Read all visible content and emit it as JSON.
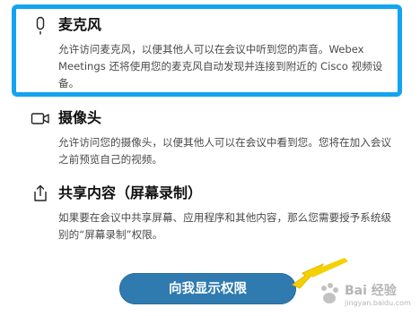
{
  "permissions": [
    {
      "id": "microphone",
      "icon": "microphone-icon",
      "title": "麦克风",
      "description": "允许访问麦克风，以便其他人可以在会议中听到您的声音。Webex Meetings 还将使用您的麦克风自动发现并连接到附近的 Cisco 视频设备。"
    },
    {
      "id": "camera",
      "icon": "camera-icon",
      "title": "摄像头",
      "description": "允许访问您的摄像头，以便其他人可以在会议中看到您。您将在加入会议之前预览自己的视频。"
    },
    {
      "id": "screen-share",
      "icon": "share-icon",
      "title": "共享内容（屏幕录制）",
      "description": "如果要在会议中共享屏幕、应用程序和其他内容，那么您需要授予系统级别的“屏幕录制”权限。"
    }
  ],
  "button": {
    "label": "向我显示权限"
  },
  "watermark": {
    "text": "Bai 经验",
    "sub": "jingyan.baidu.com"
  },
  "colors": {
    "highlight": "#12a4f0",
    "button": "#2f7bb0",
    "arrow": "#f5d000"
  }
}
